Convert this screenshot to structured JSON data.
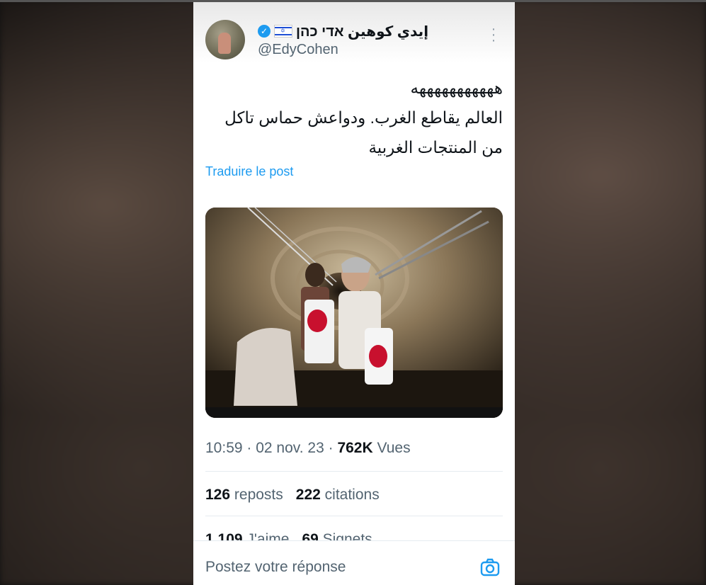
{
  "tweet": {
    "display_name": "إيدي كوهين אדי כהן",
    "handle": "@EdyCohen",
    "text_lines": [
      "هههههههههههه",
      "العالم يقاطع الغرب. ودواعش حماس تاكل",
      "من المنتجات الغربية"
    ],
    "translate_label": "Traduire le post",
    "time": "10:59",
    "date": "02 nov. 23",
    "views_count": "762K",
    "views_label": "Vues",
    "reposts_count": "126",
    "reposts_label": "reposts",
    "quotes_count": "222",
    "quotes_label": "citations",
    "likes_count": "1 109",
    "likes_label": "J'aime",
    "bookmarks_count": "69",
    "bookmarks_label": "Signets"
  },
  "reply": {
    "placeholder": "Postez votre réponse"
  },
  "colors": {
    "accent": "#1d9bf0",
    "text_primary": "#0f1419",
    "text_secondary": "#536471"
  }
}
